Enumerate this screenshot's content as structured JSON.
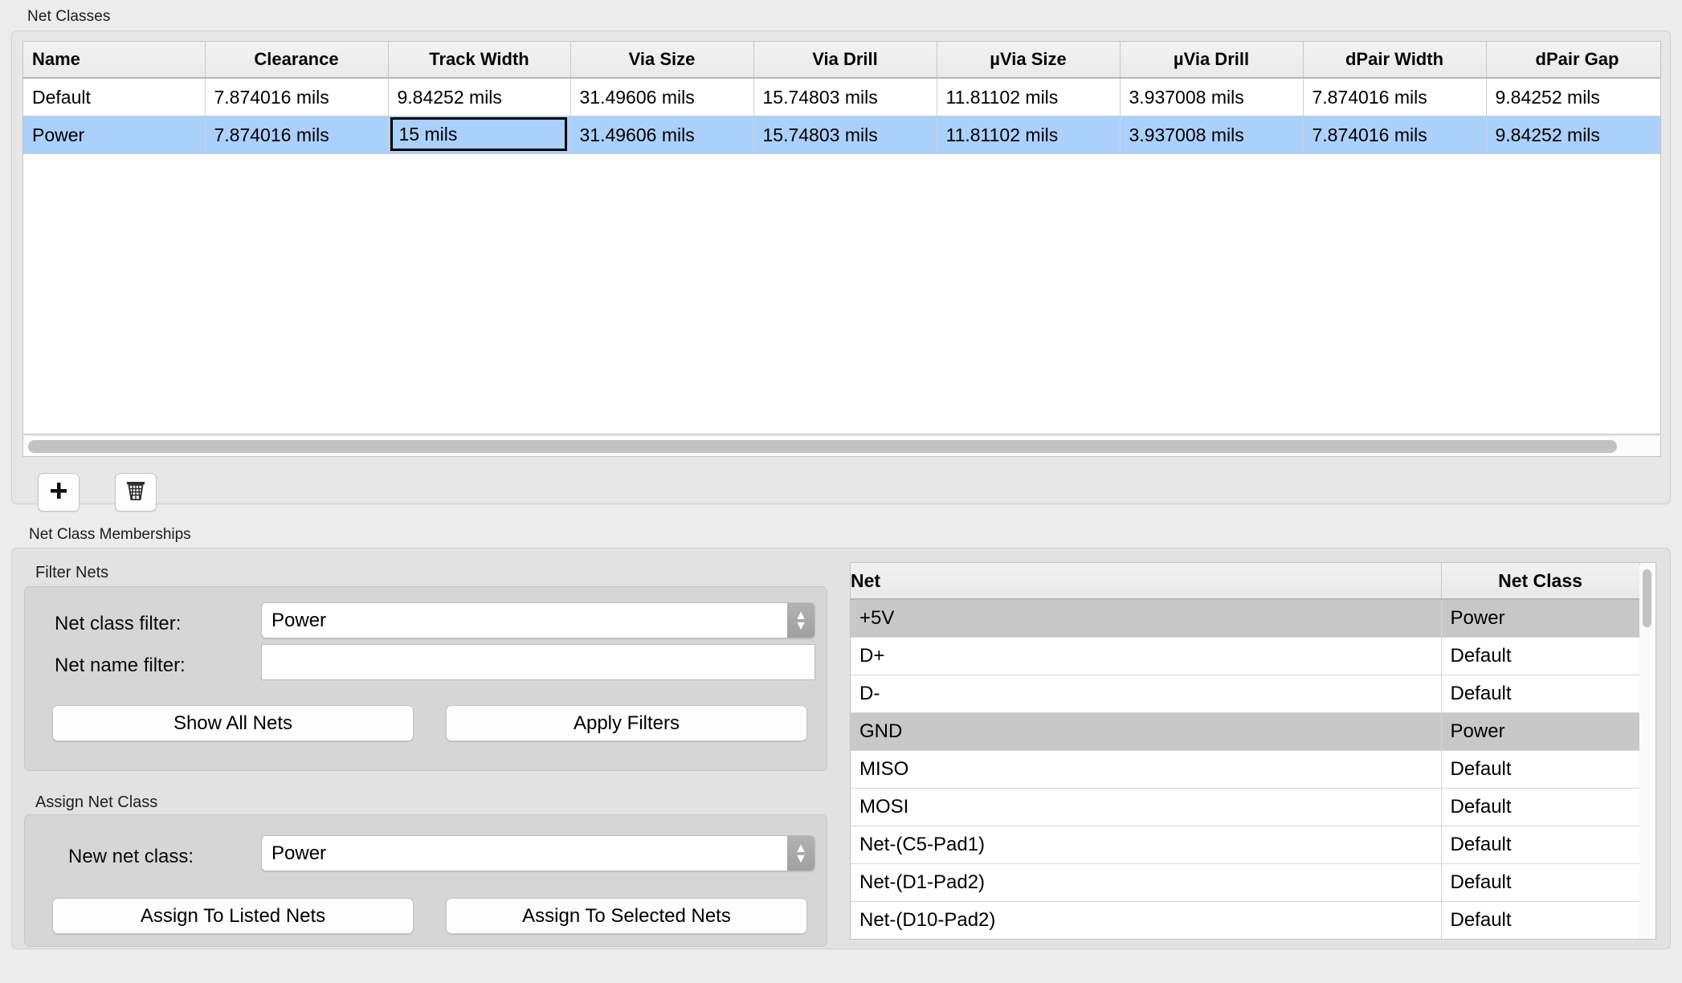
{
  "net_classes": {
    "group_label": "Net Classes",
    "columns": [
      "Name",
      "Clearance",
      "Track Width",
      "Via Size",
      "Via Drill",
      "µVia Size",
      "µVia Drill",
      "dPair Width",
      "dPair Gap"
    ],
    "rows": [
      {
        "selected": false,
        "cells": [
          "Default",
          "7.874016 mils",
          "9.84252 mils",
          "31.49606 mils",
          "15.74803 mils",
          "11.81102 mils",
          "3.937008 mils",
          "7.874016 mils",
          "9.84252 mils"
        ]
      },
      {
        "selected": true,
        "editing_column_index": 2,
        "cells": [
          "Power",
          "7.874016 mils",
          "15 mils",
          "31.49606 mils",
          "15.74803 mils",
          "11.81102 mils",
          "3.937008 mils",
          "7.874016 mils",
          "9.84252 mils"
        ]
      }
    ],
    "toolbar": {
      "add_icon": "plus-icon",
      "delete_icon": "trash-icon"
    },
    "scrollbar": {
      "orientation": "horizontal"
    }
  },
  "memberships": {
    "group_label": "Net Class Memberships",
    "filter": {
      "title": "Filter Nets",
      "net_class_filter_label": "Net class filter:",
      "net_class_filter_value": "Power",
      "net_name_filter_label": "Net name filter:",
      "net_name_filter_value": "",
      "net_name_filter_placeholder": "",
      "show_all_button": "Show All Nets",
      "apply_filters_button": "Apply Filters"
    },
    "assign": {
      "title": "Assign Net Class",
      "new_net_class_label": "New net class:",
      "new_net_class_value": "Power",
      "assign_listed_button": "Assign To Listed Nets",
      "assign_selected_button": "Assign To Selected Nets"
    },
    "netlist": {
      "columns": [
        "Net",
        "Net Class"
      ],
      "rows": [
        {
          "net": "+5V",
          "net_class": "Power",
          "highlighted": true
        },
        {
          "net": "D+",
          "net_class": "Default",
          "highlighted": false
        },
        {
          "net": "D-",
          "net_class": "Default",
          "highlighted": false
        },
        {
          "net": "GND",
          "net_class": "Power",
          "highlighted": true
        },
        {
          "net": "MISO",
          "net_class": "Default",
          "highlighted": false
        },
        {
          "net": "MOSI",
          "net_class": "Default",
          "highlighted": false
        },
        {
          "net": "Net-(C5-Pad1)",
          "net_class": "Default",
          "highlighted": false
        },
        {
          "net": "Net-(D1-Pad2)",
          "net_class": "Default",
          "highlighted": false
        },
        {
          "net": "Net-(D10-Pad2)",
          "net_class": "Default",
          "highlighted": false
        },
        {
          "net": "",
          "net_class": "",
          "highlighted": false
        }
      ]
    }
  },
  "colors": {
    "selection_blue": "#abd0fb",
    "row_highlight_gray": "#c8c8c8",
    "panel_bg": "#e7e7e7",
    "window_bg": "#ececec"
  }
}
